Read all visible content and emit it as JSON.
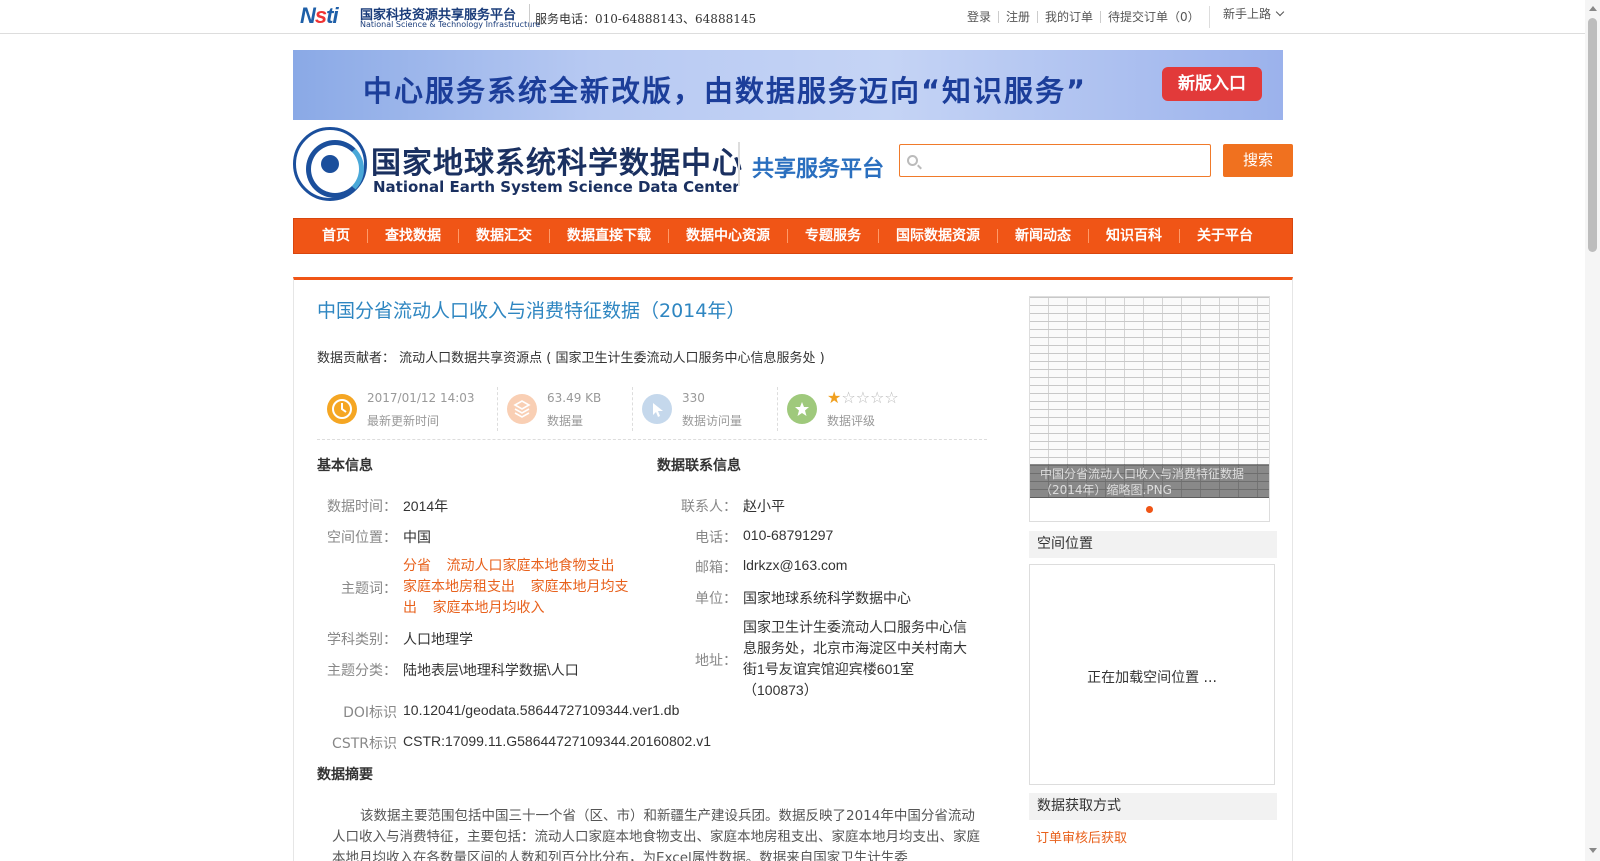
{
  "topbar": {
    "logo_cn": "国家科技资源共享服务平台",
    "logo_en": "National Science & Technology Infrastructure",
    "phone": "服务电话：010-64888143、64888145",
    "links": [
      "登录",
      "注册",
      "我的订单",
      "待提交订单（0）"
    ],
    "newbie": "新手上路"
  },
  "banner": {
    "text": "中心服务系统全新改版，由数据服务迈向“知识服务”",
    "button": "新版入口"
  },
  "header": {
    "name_cn": "国家地球系统科学数据中心",
    "name_en": "National Earth System Science Data Center",
    "platform": "共享服务平台",
    "search_placeholder": "",
    "search_button": "搜索"
  },
  "nav": [
    "首页",
    "查找数据",
    "数据汇交",
    "数据直接下载",
    "数据中心资源",
    "专题服务",
    "国际数据资源",
    "新闻动态",
    "知识百科",
    "关于平台"
  ],
  "dataset": {
    "title": "中国分省流动人口收入与消费特征数据（2014年）",
    "contributor_label": "数据贡献者：",
    "contributor": "流动人口数据共享资源点 ( 国家卫生计生委流动人口服务中心信息服务处 )",
    "stats": [
      {
        "value": "2017/01/12 14:03",
        "label": "最新更新时间",
        "icon": "clock-icon"
      },
      {
        "value": "63.49 KB",
        "label": "数据量",
        "icon": "database-icon"
      },
      {
        "value": "330",
        "label": "数据访问量",
        "icon": "visits-icon"
      },
      {
        "value": "",
        "label": "数据评级",
        "icon": "star-badge-icon"
      }
    ],
    "rating": 1,
    "rating_max": 5
  },
  "basic_info": {
    "heading": "基本信息",
    "time_label": "数据时间：",
    "time": "2014年",
    "space_label": "空间位置：",
    "space": "中国",
    "keywords_label": "主题词：",
    "keywords": [
      "分省",
      "流动人口家庭本地食物支出",
      "家庭本地房租支出",
      "家庭本地月均支出",
      "家庭本地月均收入"
    ],
    "subject_label": "学科类别：",
    "subject": "人口地理学",
    "topic_label": "主题分类：",
    "topic": "陆地表层\\地理科学数据\\人口",
    "doi_label": "DOI标识",
    "doi": "10.12041/geodata.58644727109344.ver1.db",
    "cstr_label": "CSTR标识",
    "cstr": "CSTR:17099.11.G58644727109344.20160802.v1"
  },
  "contact": {
    "heading": "数据联系信息",
    "person_label": "联系人：",
    "person": "赵小平",
    "phone_label": "电话：",
    "phone": "010-68791297",
    "email_label": "邮箱：",
    "email": "ldrkzx@163.com",
    "org_label": "单位：",
    "org": "国家地球系统科学数据中心",
    "address_label": "地址：",
    "address": "国家卫生计生委流动人口服务中心信息服务处，北京市海淀区中关村南大街1号友谊宾馆迎宾楼601室（100873）"
  },
  "abstract": {
    "heading": "数据摘要",
    "text": "该数据主要范围包括中国三十一个省（区、市）和新疆生产建设兵团。数据反映了2014年中国分省流动人口收入与消费特征，主要包括：流动人口家庭本地食物支出、家庭本地房租支出、家庭本地月均支出、家庭本地月均收入在各数量区间的人数和列百分比分布，为Excel属性数据。数据来自国家卫生计生委"
  },
  "sidebar": {
    "thumb_caption": "中国分省流动人口收入与消费特征数据（2014年）缩略图.PNG",
    "space_heading": "空间位置",
    "map_loading": "正在加载空间位置 ...",
    "access_heading": "数据获取方式",
    "access_link": "订单审核后获取"
  },
  "colors": {
    "accent": "#f05516",
    "link": "#e8611c",
    "title": "#2e86c1"
  }
}
